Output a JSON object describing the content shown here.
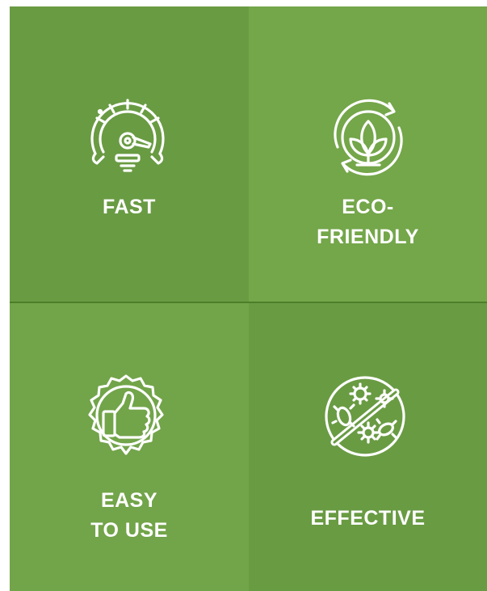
{
  "features": [
    {
      "icon": "speedometer-icon",
      "label_lines": [
        "FAST"
      ]
    },
    {
      "icon": "eco-leaf-recycle-icon",
      "label_lines": [
        "ECO-",
        "FRIENDLY"
      ]
    },
    {
      "icon": "thumbs-up-badge-icon",
      "label_lines": [
        "EASY",
        "TO USE"
      ]
    },
    {
      "icon": "no-germs-icon",
      "label_lines": [
        "EFFECTIVE"
      ]
    }
  ],
  "colors": {
    "tile_dark": "#699b43",
    "tile_light": "#74a64a",
    "divider": "#4d7f2a",
    "text": "#ffffff"
  }
}
